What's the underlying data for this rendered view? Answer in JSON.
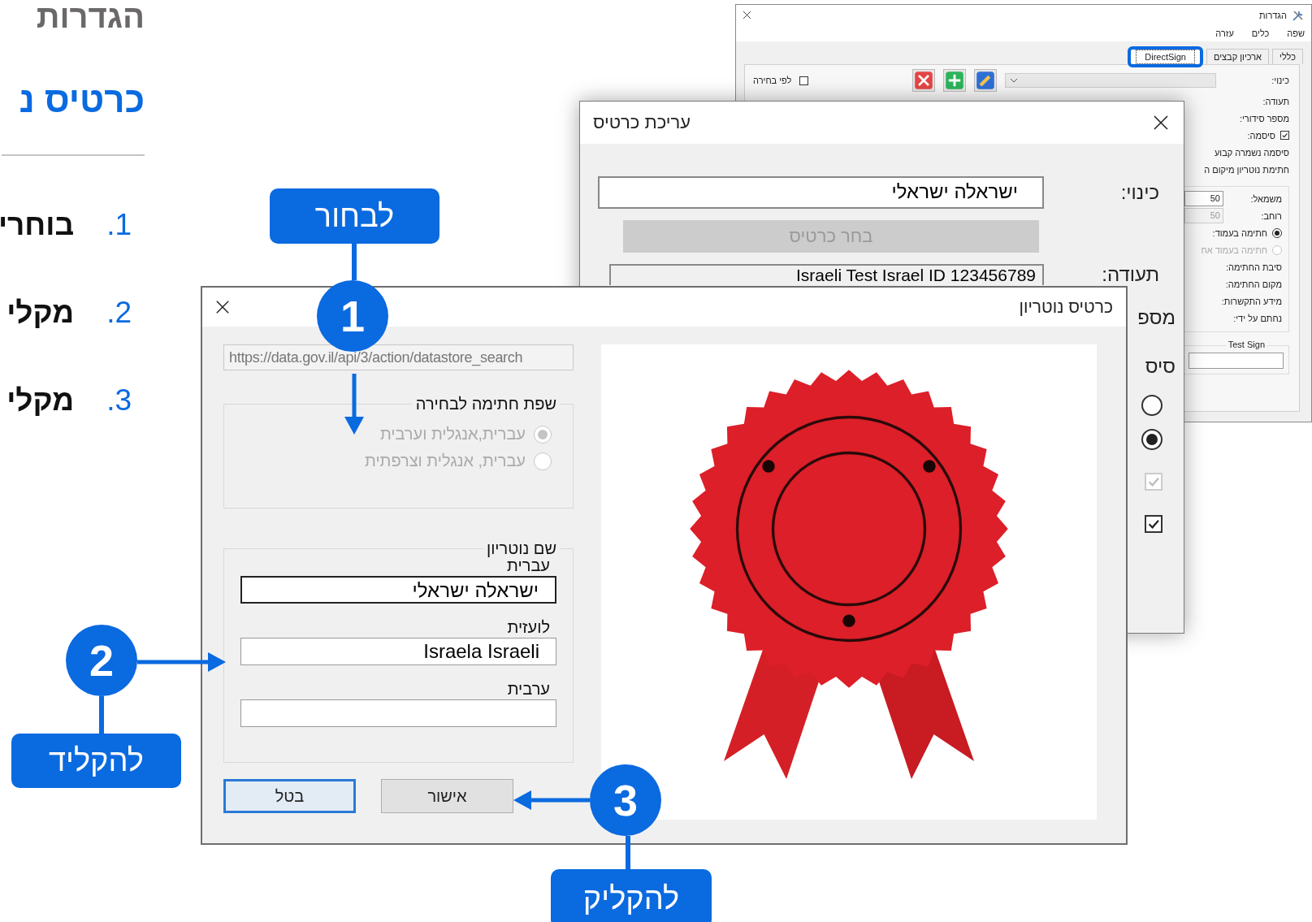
{
  "page": {
    "title": "הגדרות",
    "subtitle": "כרטיס נ",
    "steps": [
      {
        "number": "1.",
        "text": "בוחרי"
      },
      {
        "number": "2.",
        "text": "מקלי"
      },
      {
        "number": "3.",
        "text": "מקלי"
      }
    ]
  },
  "settings_window": {
    "title": "הגדרות",
    "menu": [
      "שפה",
      "כלים",
      "עזרה"
    ],
    "tabs": [
      {
        "label": "כללי",
        "selected": false,
        "highlighted": false
      },
      {
        "label": "ארכיון קבצים",
        "selected": false,
        "highlighted": false
      },
      {
        "label": "DirectSign",
        "selected": true,
        "highlighted": true
      }
    ],
    "toolbar": {
      "label": "כינוי:",
      "filter_checkbox": {
        "label": "לפי בחירה",
        "checked": false
      }
    },
    "form_rows": [
      {
        "kind": "label",
        "text": "תעודה:"
      },
      {
        "kind": "label",
        "text": "מספר סידורי:"
      },
      {
        "kind": "checkbox",
        "text": "סיסמה:",
        "checked": true
      },
      {
        "kind": "label",
        "text": "סיסמה נשמרה קבוע"
      },
      {
        "kind": "label",
        "text": "חתימת נוטריון מיקום ה"
      }
    ],
    "position_group": [
      {
        "kind": "number",
        "text": "משמאל:",
        "value": "50",
        "disabled": false
      },
      {
        "kind": "number",
        "text": "רוחב:",
        "value": "50",
        "disabled": true
      },
      {
        "kind": "radio",
        "text": "חתימה בעמוד:",
        "selected": true,
        "disabled": false
      },
      {
        "kind": "radio",
        "text": "חתימה בעמוד אח",
        "selected": false,
        "disabled": true
      },
      {
        "kind": "label",
        "text": "סיבת החתימה:"
      },
      {
        "kind": "label",
        "text": "מקום החתימה:"
      },
      {
        "kind": "label",
        "text": "מידע התקשרות:"
      },
      {
        "kind": "label",
        "text": "נחתם על ידי:"
      }
    ],
    "test_group": {
      "title": "Test Sign"
    }
  },
  "edit_dialog": {
    "title": "עריכת כרטיס",
    "rows": [
      {
        "kind": "field",
        "label": "כינוי:",
        "value": "ישראלה ישראלי"
      },
      {
        "kind": "button",
        "text": "בחר כרטיס",
        "disabled": true
      },
      {
        "kind": "field",
        "label": "תעודה:",
        "value": "Israeli Test Israel ID  123456789"
      },
      {
        "kind": "label",
        "label": "מספ"
      },
      {
        "kind": "label",
        "label": "סיס"
      },
      {
        "kind": "radio",
        "selected": false
      },
      {
        "kind": "radio",
        "selected": true
      },
      {
        "kind": "checkbox",
        "checked": true,
        "disabled": true
      },
      {
        "kind": "checkbox",
        "checked": true,
        "disabled": false
      }
    ]
  },
  "notary_dialog": {
    "title": "כרטיס נוטריון",
    "url": "https://data.gov.il/api/3/action/datastore_search",
    "language_group": {
      "title": "שפת חתימה לבחירה",
      "disabled": true,
      "options": [
        {
          "label": "עברית,אנגלית וערבית",
          "selected": true
        },
        {
          "label": "עברית, אנגלית וצרפתית",
          "selected": false
        }
      ]
    },
    "name_group": {
      "title": "שם נוטריון",
      "fields": [
        {
          "label": "עברית",
          "value": "ישראלה ישראלי",
          "focused": true
        },
        {
          "label": "לועזית",
          "value": "Israela Israeli",
          "focused": false
        },
        {
          "label": "ערבית",
          "focused": false
        }
      ]
    },
    "buttons": [
      {
        "label": "אישור",
        "default": false
      },
      {
        "label": "בטל",
        "default": true
      }
    ]
  },
  "annotations": [
    {
      "number": "1",
      "label": "לבחור"
    },
    {
      "number": "2",
      "label": "להקליד"
    },
    {
      "number": "3",
      "label": "להקליק"
    }
  ]
}
